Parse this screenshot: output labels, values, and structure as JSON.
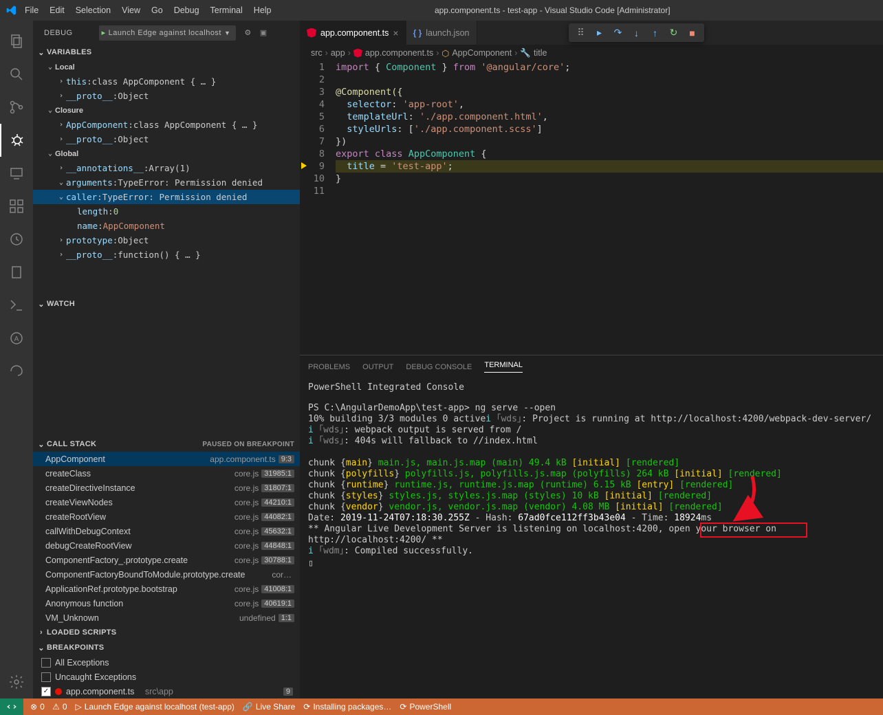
{
  "window_title": "app.component.ts - test-app - Visual Studio Code [Administrator]",
  "menus": [
    "File",
    "Edit",
    "Selection",
    "View",
    "Go",
    "Debug",
    "Terminal",
    "Help"
  ],
  "sidebar": {
    "panel_title": "DEBUG",
    "launch_config": "Launch Edge against localhost",
    "sections": {
      "variables": "VARIABLES",
      "watch": "WATCH",
      "callstack": "CALL STACK",
      "callstack_status": "PAUSED ON BREAKPOINT",
      "loaded": "LOADED SCRIPTS",
      "breakpoints": "BREAKPOINTS"
    },
    "vars": {
      "scopes": [
        "Local",
        "Closure",
        "Global"
      ],
      "local": [
        {
          "k": "this",
          "v": "class AppComponent { … }"
        },
        {
          "k": "__proto__",
          "v": "Object"
        }
      ],
      "closure": [
        {
          "k": "AppComponent",
          "v": "class AppComponent { … }"
        },
        {
          "k": "__proto__",
          "v": "Object"
        }
      ],
      "global": [
        {
          "k": "__annotations__",
          "v": "Array(1)"
        },
        {
          "k": "arguments",
          "v": "TypeError: Permission denied"
        },
        {
          "k": "caller",
          "v": "TypeError: Permission denied"
        },
        {
          "k": "length",
          "v": "0"
        },
        {
          "k": "name",
          "v": "AppComponent"
        },
        {
          "k": "prototype",
          "v": "Object"
        },
        {
          "k": "__proto__",
          "v": "function() { … }"
        }
      ]
    },
    "callstack": [
      {
        "name": "AppComponent",
        "src": "app.component.ts",
        "pos": "9:3"
      },
      {
        "name": "createClass",
        "src": "core.js",
        "pos": "31985:1"
      },
      {
        "name": "createDirectiveInstance",
        "src": "core.js",
        "pos": "31807:1"
      },
      {
        "name": "createViewNodes",
        "src": "core.js",
        "pos": "44210:1"
      },
      {
        "name": "createRootView",
        "src": "core.js",
        "pos": "44082:1"
      },
      {
        "name": "callWithDebugContext",
        "src": "core.js",
        "pos": "45632:1"
      },
      {
        "name": "debugCreateRootView",
        "src": "core.js",
        "pos": "44848:1"
      },
      {
        "name": "ComponentFactory_.prototype.create",
        "src": "core.js",
        "pos": "30788:1"
      },
      {
        "name": "ComponentFactoryBoundToModule.prototype.create",
        "src": "cor…",
        "pos": ""
      },
      {
        "name": "ApplicationRef.prototype.bootstrap",
        "src": "core.js",
        "pos": "41008:1"
      },
      {
        "name": "Anonymous function",
        "src": "core.js",
        "pos": "40619:1"
      },
      {
        "name": "VM_Unknown",
        "src": "undefined",
        "pos": "1:1"
      }
    ],
    "breakpoints": {
      "all_ex": "All Exceptions",
      "uncaught": "Uncaught Exceptions",
      "file": "app.component.ts",
      "file_path": "src\\app",
      "count": "9"
    }
  },
  "tabs": [
    {
      "label": "app.component.ts",
      "active": true
    },
    {
      "label": "launch.json",
      "active": false
    }
  ],
  "breadcrumb": [
    "src",
    "app",
    "app.component.ts",
    "AppComponent",
    "title"
  ],
  "code": {
    "lines": [
      1,
      2,
      3,
      4,
      5,
      6,
      7,
      8,
      9,
      10,
      11
    ],
    "l1": {
      "a": "import",
      "b": " { ",
      "c": "Component",
      "d": " } ",
      "e": "from",
      "f": " ",
      "g": "'@angular/core'",
      "h": ";"
    },
    "l3": "@Component({",
    "l4k": "selector",
    "l4v": "'app-root'",
    "l5k": "templateUrl",
    "l5v": "'./app.component.html'",
    "l6k": "styleUrls",
    "l6v": "'./app.component.scss'",
    "l7": "})",
    "l8": {
      "a": "export",
      "b": "class",
      "c": "AppComponent",
      "d": "{"
    },
    "l9": {
      "a": "title",
      "b": " = ",
      "c": "'test-app'",
      "d": ";"
    },
    "l10": "}"
  },
  "panel": {
    "tabs": [
      "PROBLEMS",
      "OUTPUT",
      "DEBUG CONSOLE",
      "TERMINAL"
    ],
    "title": "PowerShell Integrated Console",
    "prompt": "PS C:\\AngularDemoApp\\test-app> ng serve --open",
    "build": "10% building 3/3 modules 0 active",
    "wds1": ": Project is running at http://localhost:4200/webpack-dev-server/",
    "wds2": ": webpack output is served from /",
    "wds3": ": 404s will fallback to //index.html",
    "chunk_main": " main.js, main.js.map (main) 49.4 kB ",
    "chunk_poly": " polyfills.js, polyfills.js.map (polyfills) 264 kB ",
    "chunk_runtime": " runtime.js, runtime.js.map (runtime) 6.15 kB ",
    "chunk_styles": " styles.js, styles.js.map (styles) 10 kB ",
    "chunk_vendor": " vendor.js, vendor.js.map (vendor) 4.08 MB ",
    "date": "Date: ",
    "date_v": "2019-11-24T07:18:30.255Z",
    " hash": " - Hash: ",
    "hash_v": "67ad0fce112ff3b43e04",
    "time": " - Time: ",
    "time_v": "18924",
    "ms": "ms",
    "serve": "** Angular Live Development Server is listening on localhost:4200, open your browser on ",
    "url": "http://localhost:4200/",
    "serve_end": " **",
    "wdm": ": Compiled successfully."
  },
  "statusbar": {
    "errors": "0",
    "warnings": "0",
    "launch": "Launch Edge against localhost (test-app)",
    "live": "Live Share",
    "install": "Installing packages…",
    "ps": "PowerShell"
  }
}
